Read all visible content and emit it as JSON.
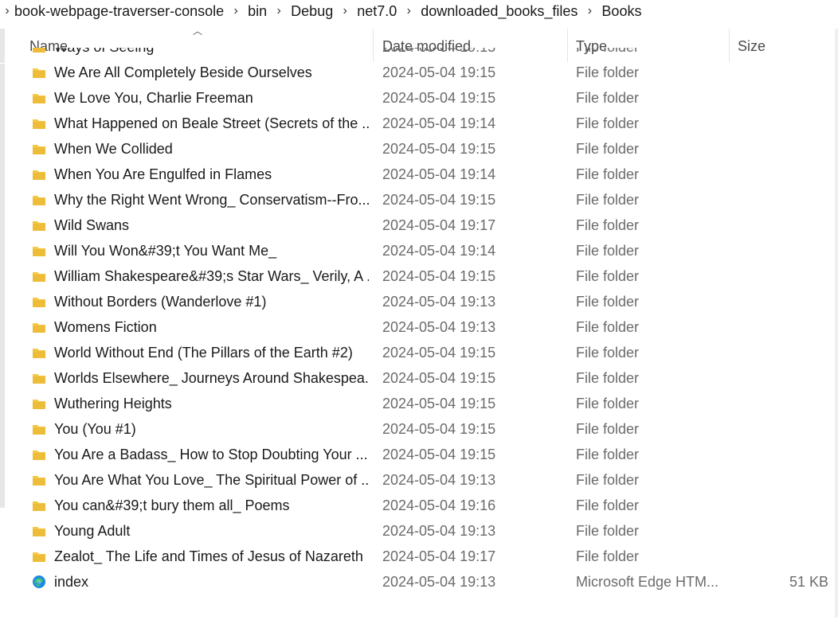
{
  "breadcrumb": {
    "segments": [
      "book-webpage-traverser-console",
      "bin",
      "Debug",
      "net7.0",
      "downloaded_books_files",
      "Books"
    ]
  },
  "columns": {
    "name": "Name",
    "date": "Date modified",
    "type": "Type",
    "size": "Size"
  },
  "colors": {
    "folder": "#f5c842",
    "folder_dark": "#e0a92a",
    "edge_blue": "#1e88e5",
    "edge_green": "#3bc46f"
  },
  "rows": [
    {
      "name": "Ways of Seeing",
      "date": "2024-05-04 19:15",
      "type": "File folder",
      "size": "",
      "icon": "folder-icon"
    },
    {
      "name": "We Are All Completely Beside Ourselves",
      "date": "2024-05-04 19:15",
      "type": "File folder",
      "size": "",
      "icon": "folder-icon"
    },
    {
      "name": "We Love You, Charlie Freeman",
      "date": "2024-05-04 19:15",
      "type": "File folder",
      "size": "",
      "icon": "folder-icon"
    },
    {
      "name": "What Happened on Beale Street (Secrets of the ...",
      "date": "2024-05-04 19:14",
      "type": "File folder",
      "size": "",
      "icon": "folder-icon"
    },
    {
      "name": "When We Collided",
      "date": "2024-05-04 19:15",
      "type": "File folder",
      "size": "",
      "icon": "folder-icon"
    },
    {
      "name": "When You Are Engulfed in Flames",
      "date": "2024-05-04 19:14",
      "type": "File folder",
      "size": "",
      "icon": "folder-icon"
    },
    {
      "name": "Why the Right Went Wrong_ Conservatism--Fro...",
      "date": "2024-05-04 19:15",
      "type": "File folder",
      "size": "",
      "icon": "folder-icon"
    },
    {
      "name": "Wild Swans",
      "date": "2024-05-04 19:17",
      "type": "File folder",
      "size": "",
      "icon": "folder-icon"
    },
    {
      "name": "Will You Won&#39;t You Want Me_",
      "date": "2024-05-04 19:14",
      "type": "File folder",
      "size": "",
      "icon": "folder-icon"
    },
    {
      "name": "William Shakespeare&#39;s Star Wars_ Verily, A ...",
      "date": "2024-05-04 19:15",
      "type": "File folder",
      "size": "",
      "icon": "folder-icon"
    },
    {
      "name": "Without Borders (Wanderlove #1)",
      "date": "2024-05-04 19:13",
      "type": "File folder",
      "size": "",
      "icon": "folder-icon"
    },
    {
      "name": "Womens Fiction",
      "date": "2024-05-04 19:13",
      "type": "File folder",
      "size": "",
      "icon": "folder-icon"
    },
    {
      "name": "World Without End (The Pillars of the Earth #2)",
      "date": "2024-05-04 19:15",
      "type": "File folder",
      "size": "",
      "icon": "folder-icon"
    },
    {
      "name": "Worlds Elsewhere_ Journeys Around Shakespea...",
      "date": "2024-05-04 19:15",
      "type": "File folder",
      "size": "",
      "icon": "folder-icon"
    },
    {
      "name": "Wuthering Heights",
      "date": "2024-05-04 19:15",
      "type": "File folder",
      "size": "",
      "icon": "folder-icon"
    },
    {
      "name": "You (You #1)",
      "date": "2024-05-04 19:15",
      "type": "File folder",
      "size": "",
      "icon": "folder-icon"
    },
    {
      "name": "You Are a Badass_ How to Stop Doubting Your ...",
      "date": "2024-05-04 19:15",
      "type": "File folder",
      "size": "",
      "icon": "folder-icon"
    },
    {
      "name": "You Are What You Love_ The Spiritual Power of ...",
      "date": "2024-05-04 19:13",
      "type": "File folder",
      "size": "",
      "icon": "folder-icon"
    },
    {
      "name": "You can&#39;t bury them all_ Poems",
      "date": "2024-05-04 19:16",
      "type": "File folder",
      "size": "",
      "icon": "folder-icon"
    },
    {
      "name": "Young Adult",
      "date": "2024-05-04 19:13",
      "type": "File folder",
      "size": "",
      "icon": "folder-icon"
    },
    {
      "name": "Zealot_ The Life and Times of Jesus of Nazareth",
      "date": "2024-05-04 19:17",
      "type": "File folder",
      "size": "",
      "icon": "folder-icon"
    },
    {
      "name": "index",
      "date": "2024-05-04 19:13",
      "type": "Microsoft Edge HTM...",
      "size": "51 KB",
      "icon": "edge-html-icon"
    }
  ]
}
